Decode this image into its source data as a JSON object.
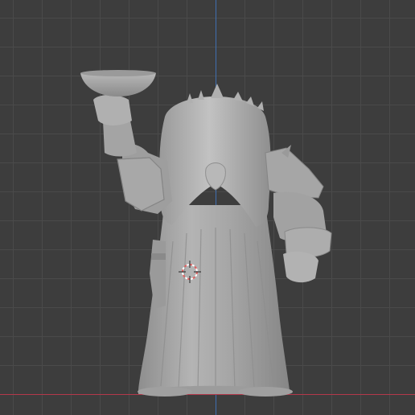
{
  "viewport": {
    "view": "3d-viewport",
    "background_color": "#3d3d3d",
    "grid_minor_color": "#444444",
    "grid_major_color": "#4a4a4a",
    "x_axis_color": "#b3384a",
    "z_axis_color": "#3f6fb0"
  },
  "model": {
    "type": "sculpted-figure",
    "shading": "solid-matcap-gray",
    "base_color": "#a9a9a9",
    "highlight_color": "#c8c8c8",
    "shadow_color": "#7c7c7c"
  },
  "cursor": {
    "type": "3d-cursor",
    "ring_colors": [
      "#e06060",
      "#ffffff"
    ]
  }
}
